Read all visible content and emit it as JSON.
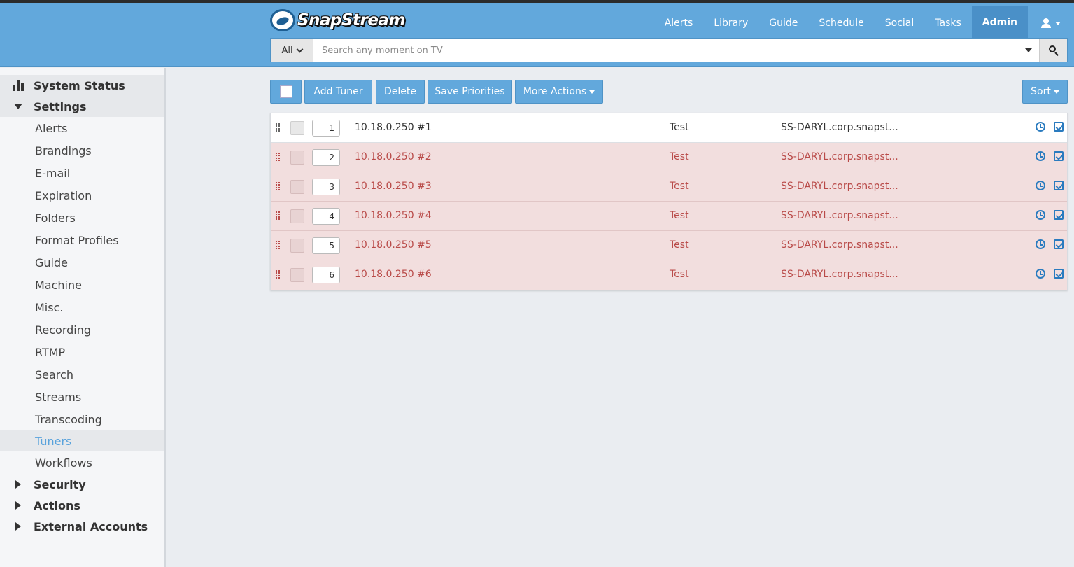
{
  "app": {
    "brand": "SnapStream"
  },
  "nav": {
    "items": [
      "Alerts",
      "Library",
      "Guide",
      "Schedule",
      "Social",
      "Tasks",
      "Admin"
    ],
    "active": "Admin",
    "user_icon": "user-icon"
  },
  "search": {
    "scope": "All",
    "placeholder": "Search any moment on TV"
  },
  "sidebar": {
    "system_status": "System Status",
    "settings": "Settings",
    "settings_items": [
      "Alerts",
      "Brandings",
      "E-mail",
      "Expiration",
      "Folders",
      "Format Profiles",
      "Guide",
      "Machine",
      "Misc.",
      "Recording",
      "RTMP",
      "Search",
      "Streams",
      "Transcoding",
      "Tuners",
      "Workflows"
    ],
    "active_item": "Tuners",
    "security": "Security",
    "actions": "Actions",
    "external_accounts": "External Accounts"
  },
  "toolbar": {
    "add_tuner": "Add Tuner",
    "delete": "Delete",
    "save_priorities": "Save Priorities",
    "more_actions": "More Actions",
    "sort": "Sort"
  },
  "tuners": [
    {
      "priority": "1",
      "name": "10.18.0.250 #1",
      "group": "Test",
      "host": "SS-DARYL.corp.snapst...",
      "status": "ok"
    },
    {
      "priority": "2",
      "name": "10.18.0.250 #2",
      "group": "Test",
      "host": "SS-DARYL.corp.snapst...",
      "status": "error"
    },
    {
      "priority": "3",
      "name": "10.18.0.250 #3",
      "group": "Test",
      "host": "SS-DARYL.corp.snapst...",
      "status": "error"
    },
    {
      "priority": "4",
      "name": "10.18.0.250 #4",
      "group": "Test",
      "host": "SS-DARYL.corp.snapst...",
      "status": "error"
    },
    {
      "priority": "5",
      "name": "10.18.0.250 #5",
      "group": "Test",
      "host": "SS-DARYL.corp.snapst...",
      "status": "error"
    },
    {
      "priority": "6",
      "name": "10.18.0.250 #6",
      "group": "Test",
      "host": "SS-DARYL.corp.snapst...",
      "status": "error"
    }
  ],
  "colors": {
    "header": "#62a8dc",
    "accent": "#5aa3dc",
    "error_row": "#f2dede",
    "error_text": "#b94a48"
  }
}
